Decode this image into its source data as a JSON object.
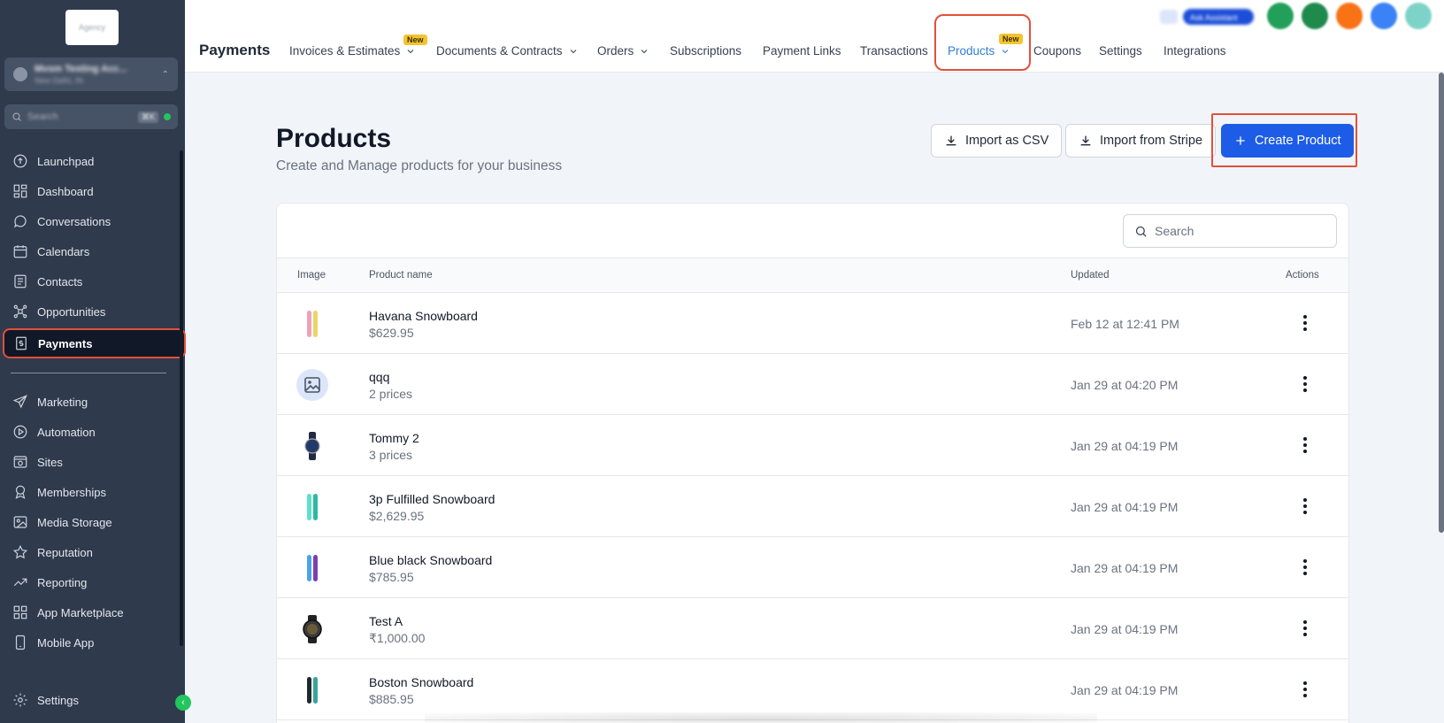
{
  "sidebar": {
    "logo_text": "Agency",
    "account": {
      "name": "Mvsm Testing Acc...",
      "location": "New Delhi, IN"
    },
    "search": {
      "placeholder": "Search",
      "shortcut": "⌘K"
    },
    "items": [
      {
        "label": "Launchpad",
        "icon": "rocket-icon"
      },
      {
        "label": "Dashboard",
        "icon": "grid-icon"
      },
      {
        "label": "Conversations",
        "icon": "chat-bubble-icon"
      },
      {
        "label": "Calendars",
        "icon": "calendar-icon"
      },
      {
        "label": "Contacts",
        "icon": "contact-card-icon"
      },
      {
        "label": "Opportunities",
        "icon": "network-icon"
      },
      {
        "label": "Payments",
        "icon": "receipt-dollar-icon",
        "active": true
      },
      {
        "label": "Marketing",
        "icon": "paper-plane-icon"
      },
      {
        "label": "Automation",
        "icon": "play-circle-icon"
      },
      {
        "label": "Sites",
        "icon": "globe-window-icon"
      },
      {
        "label": "Memberships",
        "icon": "award-icon"
      },
      {
        "label": "Media Storage",
        "icon": "image-icon"
      },
      {
        "label": "Reputation",
        "icon": "star-icon"
      },
      {
        "label": "Reporting",
        "icon": "trend-up-icon"
      },
      {
        "label": "App Marketplace",
        "icon": "grid-plus-icon"
      },
      {
        "label": "Mobile App",
        "icon": "mobile-icon"
      }
    ],
    "settings_label": "Settings"
  },
  "topbar": {
    "title": "Payments",
    "tabs": [
      {
        "label": "Invoices & Estimates",
        "chevron": true,
        "badge": "New"
      },
      {
        "label": "Documents & Contracts",
        "chevron": true
      },
      {
        "label": "Orders",
        "chevron": true
      },
      {
        "label": "Subscriptions"
      },
      {
        "label": "Payment Links"
      },
      {
        "label": "Transactions"
      },
      {
        "label": "Products",
        "chevron": true,
        "badge": "New",
        "active": true
      },
      {
        "label": "Coupons"
      },
      {
        "label": "Settings"
      },
      {
        "label": "Integrations"
      }
    ],
    "pill_label": "Ask Assistant"
  },
  "main": {
    "title": "Products",
    "subtitle": "Create and Manage products for your business",
    "buttons": {
      "import_csv": "Import as CSV",
      "import_stripe": "Import from Stripe",
      "create": "Create Product"
    },
    "search_placeholder": "Search",
    "columns": {
      "image": "Image",
      "name": "Product name",
      "updated": "Updated",
      "actions": "Actions"
    },
    "rows": [
      {
        "name": "Havana Snowboard",
        "sub": "$629.95",
        "updated": "Feb 12 at 12:41 PM",
        "thumb": "snowboard-pink-yellow"
      },
      {
        "name": "qqq",
        "sub": "2 prices",
        "updated": "Jan 29 at 04:20 PM",
        "thumb": "placeholder-image"
      },
      {
        "name": "Tommy 2",
        "sub": "3 prices",
        "updated": "Jan 29 at 04:19 PM",
        "thumb": "watch-navy"
      },
      {
        "name": "3p Fulfilled Snowboard",
        "sub": "$2,629.95",
        "updated": "Jan 29 at 04:19 PM",
        "thumb": "snowboard-teal"
      },
      {
        "name": "Blue black Snowboard",
        "sub": "$785.95",
        "updated": "Jan 29 at 04:19 PM",
        "thumb": "snowboard-blue-purple"
      },
      {
        "name": "Test A",
        "sub": "₹1,000.00",
        "updated": "Jan 29 at 04:19 PM",
        "thumb": "watch-black"
      },
      {
        "name": "Boston Snowboard",
        "sub": "$885.95",
        "updated": "Jan 29 at 04:19 PM",
        "thumb": "snowboard-dark-teal"
      }
    ]
  },
  "colors": {
    "sidebar_bg": "#2f3a4d",
    "primary": "#1d5ce6",
    "highlight": "#e3503b",
    "active_tab": "#2f7fd6",
    "badge": "#f4c430"
  }
}
